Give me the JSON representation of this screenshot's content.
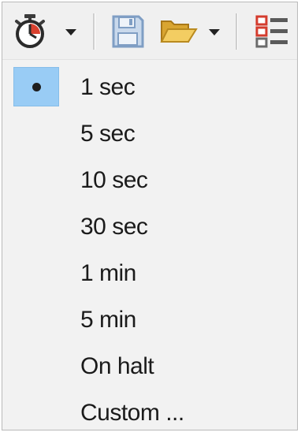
{
  "toolbar": {
    "buttons": [
      {
        "icon": "stopwatch-icon",
        "has_dropdown": true
      },
      {
        "icon": "save-icon",
        "has_dropdown": false
      },
      {
        "icon": "open-folder-icon",
        "has_dropdown": true
      },
      {
        "icon": "list-view-icon",
        "has_dropdown": false
      }
    ]
  },
  "menu": {
    "selected_index": 0,
    "items": [
      {
        "label": "1 sec"
      },
      {
        "label": "5 sec"
      },
      {
        "label": "10 sec"
      },
      {
        "label": "30 sec"
      },
      {
        "label": "1 min"
      },
      {
        "label": "5 min"
      },
      {
        "label": "On halt"
      },
      {
        "label": "Custom ..."
      }
    ]
  },
  "colors": {
    "selection_bg": "#99ccf5",
    "menu_bg": "#f2f2f2",
    "text": "#1b1b1b"
  }
}
